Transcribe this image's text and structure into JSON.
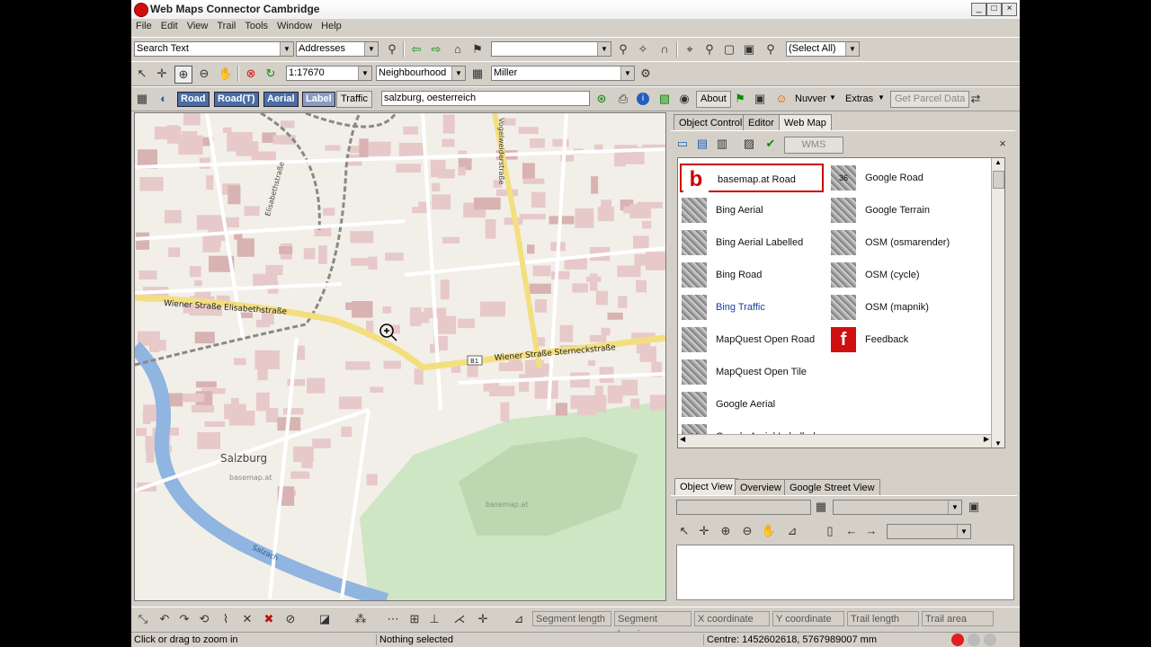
{
  "window": {
    "title": "Web Maps Connector Cambridge"
  },
  "menu": [
    "File",
    "Edit",
    "View",
    "Trail",
    "Tools",
    "Window",
    "Help"
  ],
  "toolbar1": {
    "search_text": "Search Text",
    "search_type": "Addresses",
    "layer_select": "",
    "select_all": "(Select All)"
  },
  "toolbar2": {
    "scale": "1:17670",
    "level": "Neighbourhood",
    "name": "Miller"
  },
  "toolbar3": {
    "road": "Road",
    "road_t": "Road(T)",
    "aerial": "Aerial",
    "label": "Label",
    "traffic": "Traffic",
    "location_value": "salzburg, oesterreich",
    "about": "About",
    "nuvver": "Nuvver",
    "extras": "Extras",
    "get_parcel": "Get Parcel Data"
  },
  "map": {
    "city_label": "Salzburg",
    "river_label": "Salzach",
    "street1": "Wiener Straße Elisabethstraße",
    "street2": "Wiener Straße Sterneckstraße",
    "street3": "Elisabethstraße",
    "street4": "Vogelweiderstraße",
    "route_badge": "B1",
    "url_label": "basemap.at",
    "url_label2": "basemap.at",
    "colors": {
      "road": "#f3df80",
      "block": "#e7c9c9",
      "water": "#8fb5e0",
      "park": "#cfe6c5"
    }
  },
  "panel": {
    "tabs": [
      "Object Control",
      "Editor",
      "Web Map"
    ],
    "active_tab": "Web Map",
    "wms_button": "WMS",
    "maps_left": [
      "basemap.at Road",
      "Bing Aerial",
      "Bing Aerial Labelled",
      "Bing Road",
      "Bing Traffic",
      "MapQuest Open Road",
      "MapQuest Open Tile",
      "Google Aerial",
      "Google Aerial Labelled"
    ],
    "maps_right": [
      "Google Road",
      "Google Terrain",
      "OSM (osmarender)",
      "OSM (cycle)",
      "OSM (mapnik)",
      "Feedback"
    ],
    "selected_map": "basemap.at Road",
    "bottom_tabs": [
      "Object View",
      "Overview",
      "Google Street View"
    ]
  },
  "bottom_toolbar": {
    "fields": [
      "Segment length",
      "Segment bearing",
      "X coordinate",
      "Y coordinate",
      "Trail length",
      "Trail area"
    ]
  },
  "status": {
    "hint": "Click or drag to zoom in",
    "selection": "Nothing selected",
    "centre": "Centre: 1452602618, 5767989007 mm"
  }
}
